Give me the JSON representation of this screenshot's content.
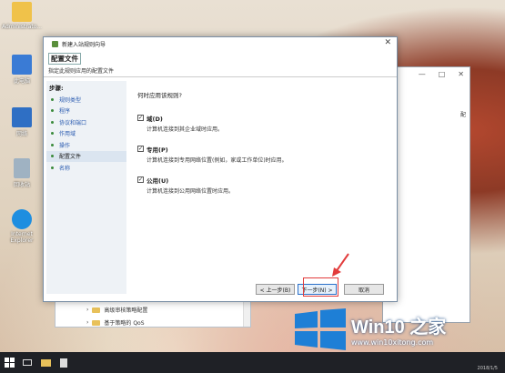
{
  "desktop": {
    "icons": [
      {
        "label": "Administrato...",
        "icon": "user-folder-icon",
        "color": "#f0c24a"
      },
      {
        "label": "此电脑",
        "icon": "computer-icon",
        "color": "#3a7bd5"
      },
      {
        "label": "网络",
        "icon": "network-icon",
        "color": "#3a7bd5"
      },
      {
        "label": "回收站",
        "icon": "recycle-bin-icon",
        "color": "#9ab"
      },
      {
        "label": "Internet Explorer",
        "icon": "ie-icon",
        "color": "#1e8ee0"
      }
    ]
  },
  "back_window": {
    "minimize": "—",
    "maximize": "□",
    "close": "✕",
    "edge_text": "配"
  },
  "explorer": {
    "rows": [
      {
        "label": "高级审核策略配置"
      },
      {
        "label": "基于策略的 QoS"
      }
    ]
  },
  "wizard": {
    "title": "新建入站规则向导",
    "close": "✕",
    "header": "配置文件",
    "subtitle": "指定此规则应用的配置文件",
    "steps_label": "步骤:",
    "steps": [
      "规则类型",
      "程序",
      "协议和端口",
      "作用域",
      "操作",
      "配置文件",
      "名称"
    ],
    "active_step": 5,
    "question": "何时应用该规则?",
    "options": [
      {
        "checked": true,
        "title": "域(D)",
        "desc": "计算机连接到其企业域时应用。"
      },
      {
        "checked": true,
        "title": "专用(P)",
        "desc": "计算机连接到专用网络位置(例如，家或工作单位)时应用。"
      },
      {
        "checked": true,
        "title": "公用(U)",
        "desc": "计算机连接到公用网络位置时应用。"
      }
    ],
    "buttons": {
      "prev": "< 上一步(B)",
      "next": "下一步(N) >",
      "cancel": "取消"
    }
  },
  "taskbar": {
    "tray_text": "2018/1/5"
  },
  "watermark": {
    "brand": "Win10 之家",
    "url": "www.win10xitong.com"
  },
  "colors": {
    "accent_red": "#e23c3c",
    "step_link": "#2a5bb0",
    "taskbar": "#1f2126"
  }
}
